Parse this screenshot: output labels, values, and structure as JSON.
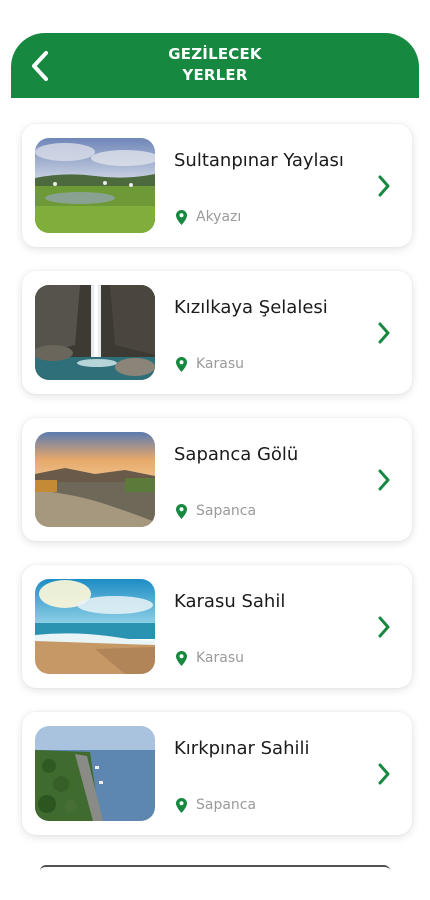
{
  "header": {
    "title_line1": "GEZİLECEK",
    "title_line2": "YERLER",
    "bg_color": "#16883f"
  },
  "icons": {
    "back": "chevron-left-icon",
    "location": "map-pin-icon",
    "arrow": "chevron-right-icon"
  },
  "places": [
    {
      "name": "Sultanpınar Yaylası",
      "location": "Akyazı"
    },
    {
      "name": "Kızılkaya Şelalesi",
      "location": "Karasu"
    },
    {
      "name": "Sapanca Gölü",
      "location": "Sapanca"
    },
    {
      "name": "Karasu Sahil",
      "location": "Karasu"
    },
    {
      "name": "Kırkpınar Sahili",
      "location": "Sapanca"
    }
  ],
  "accent_color": "#16883f"
}
